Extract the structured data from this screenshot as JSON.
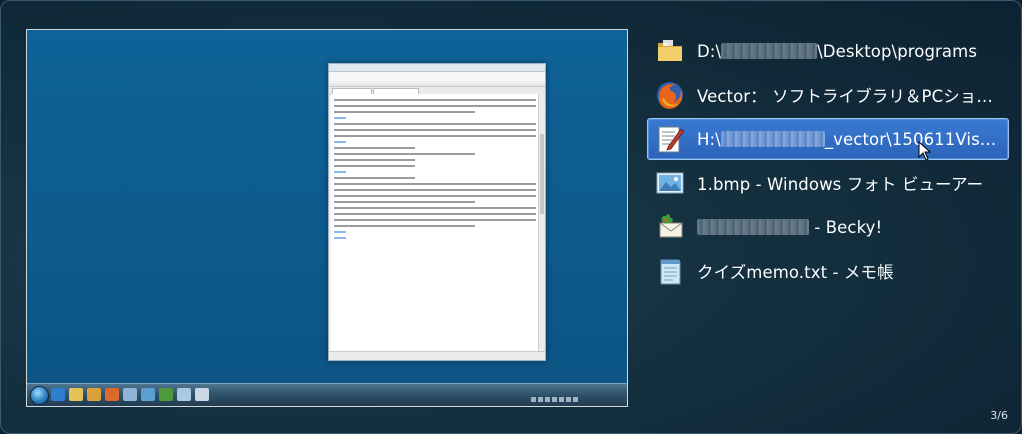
{
  "switcher": {
    "counter": "3/6",
    "windows": [
      {
        "icon": "folder-icon",
        "title_prefix": "D:\\",
        "title_suffix": "\\Desktop\\programs",
        "selected": false
      },
      {
        "icon": "firefox-icon",
        "title": "Vector： ソフトライブラリ＆PCショ…",
        "selected": false
      },
      {
        "icon": "text-editor-icon",
        "title_prefix": "H:\\",
        "title_suffix": "_vector\\150611Vista…",
        "selected": true
      },
      {
        "icon": "photo-viewer-icon",
        "title": "1.bmp - Windows フォト ビューアー",
        "selected": false
      },
      {
        "icon": "mail-client-icon",
        "title_suffix": " - Becky!",
        "selected": false
      },
      {
        "icon": "notepad-icon",
        "title": "クイズmemo.txt - メモ帳",
        "selected": false
      }
    ]
  },
  "colors": {
    "selection": "#2c64b9",
    "background": "#14303f",
    "desktop": "#0f5b8a"
  }
}
